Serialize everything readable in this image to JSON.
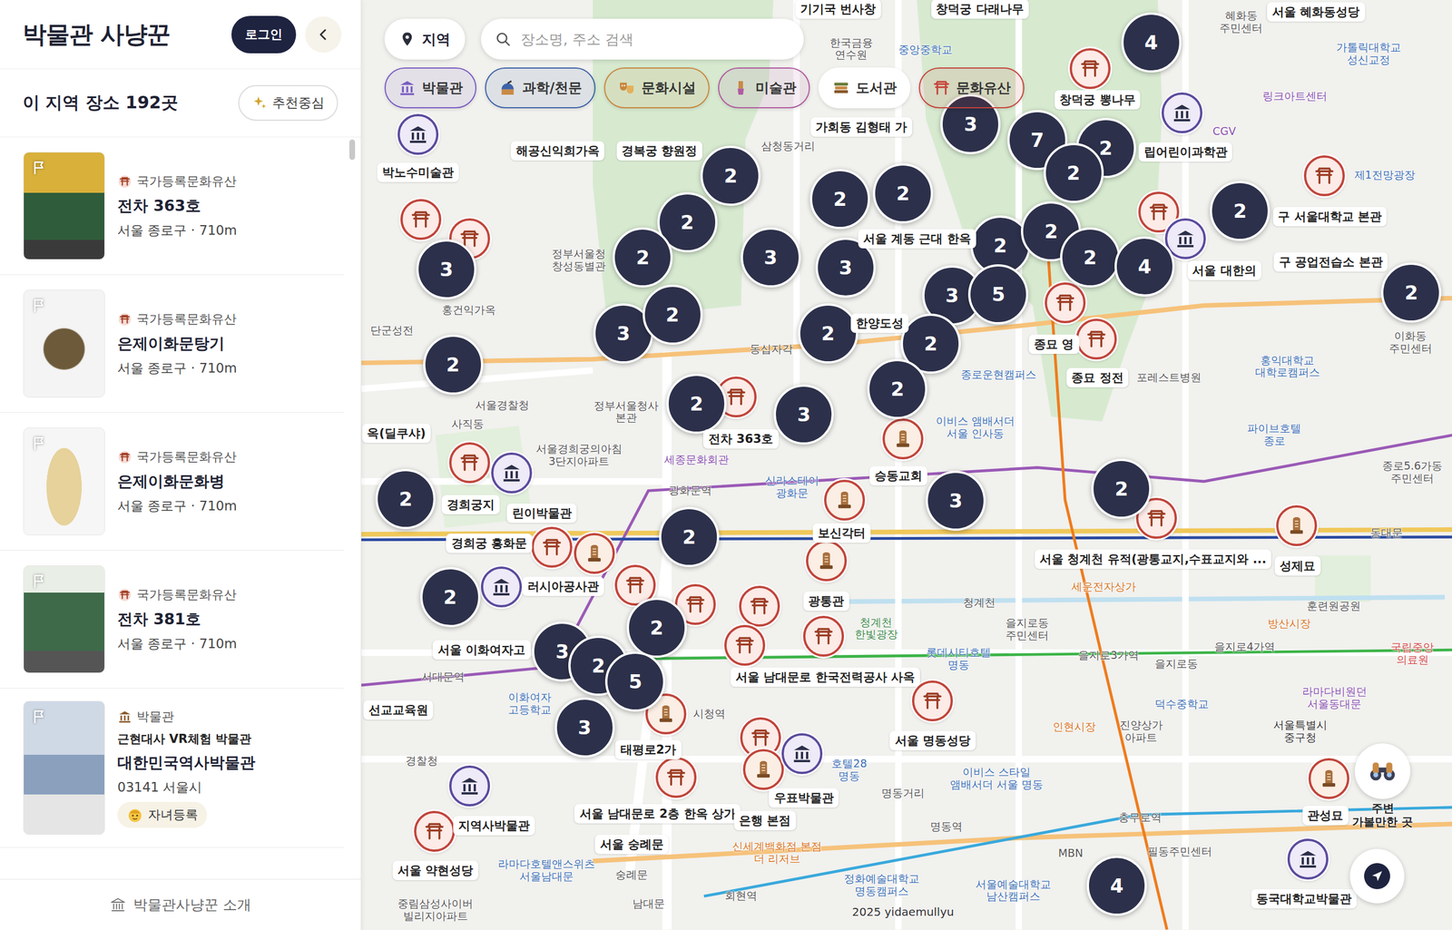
{
  "sidebar": {
    "title": "박물관 사냥꾼",
    "login": "로그인",
    "count": "이 지역 장소 192곳",
    "sort": "추천중심",
    "footer": "박물관사냥꾼 소개"
  },
  "places": [
    {
      "kind": "heritage",
      "category": "국가등록문화유산",
      "title": "전차 363호",
      "meta": "서울 종로구 · 710m"
    },
    {
      "kind": "heritage",
      "category": "국가등록문화유산",
      "title": "은제이화문탕기",
      "meta": "서울 종로구 · 710m"
    },
    {
      "kind": "heritage",
      "category": "국가등록문화유산",
      "title": "은제이화문화병",
      "meta": "서울 종로구 · 710m"
    },
    {
      "kind": "heritage",
      "category": "국가등록문화유산",
      "title": "전차 381호",
      "meta": "서울 종로구 · 710m"
    },
    {
      "kind": "museum",
      "category": "박물관",
      "subtitle": "근현대사 VR체험 박물관",
      "title": "대한민국역사박물관",
      "meta": "03141 서울시",
      "badge": "자녀등록"
    }
  ],
  "map": {
    "region": "지역",
    "search_placeholder": "장소명, 주소 검색",
    "filters": [
      {
        "label": "박물관",
        "kind": "museum",
        "selected": true,
        "color": "#7a5cc2"
      },
      {
        "label": "과학/천문",
        "kind": "science",
        "selected": true,
        "color": "#3f63a8"
      },
      {
        "label": "문화시설",
        "kind": "culture",
        "selected": true,
        "color": "#c8873f"
      },
      {
        "label": "미술관",
        "kind": "art",
        "selected": true,
        "color": "#b05aa0"
      },
      {
        "label": "도서관",
        "kind": "library",
        "selected": false,
        "color": "#6b7d3a"
      },
      {
        "label": "문화유산",
        "kind": "heritage",
        "selected": true,
        "color": "#c7443b"
      }
    ],
    "clusters": [
      {
        "count": "4"
      },
      {
        "count": "3"
      },
      {
        "count": "7"
      },
      {
        "count": "2"
      },
      {
        "count": "2"
      },
      {
        "count": "2"
      },
      {
        "count": "2"
      },
      {
        "count": "2"
      },
      {
        "count": "2"
      },
      {
        "count": "2"
      },
      {
        "count": "2"
      },
      {
        "count": "3"
      },
      {
        "count": "3"
      },
      {
        "count": "2"
      },
      {
        "count": "2"
      },
      {
        "count": "2"
      },
      {
        "count": "4"
      },
      {
        "count": "3"
      },
      {
        "count": "5"
      },
      {
        "count": "2"
      },
      {
        "count": "3"
      },
      {
        "count": "2"
      },
      {
        "count": "3"
      },
      {
        "count": "2"
      },
      {
        "count": "2"
      },
      {
        "count": "2"
      },
      {
        "count": "2"
      },
      {
        "count": "2"
      },
      {
        "count": "3"
      },
      {
        "count": "3"
      },
      {
        "count": "2"
      },
      {
        "count": "2"
      },
      {
        "count": "2"
      },
      {
        "count": "2"
      },
      {
        "count": "2"
      },
      {
        "count": "3"
      },
      {
        "count": "2"
      },
      {
        "count": "5"
      },
      {
        "count": "3"
      },
      {
        "count": "4"
      }
    ],
    "pins": [
      {
        "kind": "heritage"
      },
      {
        "kind": "heritage"
      },
      {
        "kind": "heritage"
      },
      {
        "kind": "heritage"
      },
      {
        "kind": "heritage"
      },
      {
        "kind": "heritage"
      },
      {
        "kind": "heritage"
      },
      {
        "kind": "heritage"
      },
      {
        "kind": "stele"
      },
      {
        "kind": "stele"
      },
      {
        "kind": "heritage"
      },
      {
        "kind": "heritage"
      },
      {
        "kind": "stele"
      },
      {
        "kind": "stele"
      },
      {
        "kind": "stele"
      },
      {
        "kind": "heritage"
      },
      {
        "kind": "heritage"
      },
      {
        "kind": "heritage"
      },
      {
        "kind": "heritage"
      },
      {
        "kind": "heritage"
      },
      {
        "kind": "heritage"
      },
      {
        "kind": "stele"
      },
      {
        "kind": "heritage"
      },
      {
        "kind": "stele"
      },
      {
        "kind": "heritage"
      },
      {
        "kind": "heritage"
      },
      {
        "kind": "heritage"
      },
      {
        "kind": "stele"
      },
      {
        "kind": "museum"
      },
      {
        "kind": "museum"
      },
      {
        "kind": "museum"
      },
      {
        "kind": "museum"
      },
      {
        "kind": "museum"
      },
      {
        "kind": "museum"
      },
      {
        "kind": "museum"
      },
      {
        "kind": "museum"
      }
    ],
    "poi_labels": [
      "기기국 번사창",
      "창덕궁 다래나무",
      "서울 혜화동성당",
      "가회동 김형태 가",
      "창덕궁 뽕나무",
      "립어린이과학관",
      "구 서울대학교 본관",
      "구 공업전습소 본관",
      "서울 대한의",
      "해공신익희가옥",
      "경복궁 향원정",
      "박노수미술관",
      "서울 계동 근대 한옥",
      "한양도성",
      "종묘 영",
      "종묘 정전",
      "전차 363호",
      "옥(딜쿠샤)",
      "경희궁지",
      "린이박물관",
      "경희궁 흥화문",
      "러시아공사관",
      "보신각터",
      "광통관",
      "승동교회",
      "서울 청계천 유적(광통교지,수표교지와 ...",
      "성제묘",
      "서울 이화여자고",
      "서울 남대문로 한국전력공사 사옥",
      "서울 명동성당",
      "태평로2가",
      "서울 남대문로 2층 한옥 상가",
      "서울 숭례문",
      "서울 약현성당",
      "지역사박물관",
      "우표박물관",
      "은행 본점",
      "관성묘",
      "동국대학교박물관",
      "선교교육원"
    ],
    "base_labels": [
      {
        "text": "혜화동\n주민센터",
        "color": "#555555"
      },
      {
        "text": "가톨릭대학교\n성신교정",
        "color": "#3b6fb6"
      },
      {
        "text": "링크아트센터",
        "color": "#8a4fb0"
      },
      {
        "text": "CGV",
        "color": "#8a4fb0"
      },
      {
        "text": "제1전망광장",
        "color": "#3b6fb6"
      },
      {
        "text": "이화동\n주민센터",
        "color": "#555555"
      },
      {
        "text": "홍익대학교\n대학로캠퍼스",
        "color": "#3b6fb6"
      },
      {
        "text": "파이브호텔\n종로",
        "color": "#3b6fb6"
      },
      {
        "text": "포레스트병원",
        "color": "#555555"
      },
      {
        "text": "종로5.6가동\n주민센터",
        "color": "#555555"
      },
      {
        "text": "동대문",
        "color": "#555555"
      },
      {
        "text": "방산시장",
        "color": "#d9731b"
      },
      {
        "text": "훈련원공원",
        "color": "#555555"
      },
      {
        "text": "국립중앙\n의료원",
        "color": "#d44a4a"
      },
      {
        "text": "라마다비원던\n서울동대문",
        "color": "#8a4fb0"
      },
      {
        "text": "을지로4가역",
        "color": "#555555"
      },
      {
        "text": "을지로3가역",
        "color": "#555555"
      },
      {
        "text": "을지로동",
        "color": "#555555"
      },
      {
        "text": "덕수중학교",
        "color": "#3b6fb6"
      },
      {
        "text": "서울특별시\n중구청",
        "color": "#333333"
      },
      {
        "text": "진양상가\n아파트",
        "color": "#555555"
      },
      {
        "text": "충무로역",
        "color": "#555555"
      },
      {
        "text": "필동주민센터",
        "color": "#555555"
      },
      {
        "text": "세운전자상가",
        "color": "#d9731b"
      },
      {
        "text": "청계천",
        "color": "#555555"
      },
      {
        "text": "을지로동\n주민센터",
        "color": "#555555"
      },
      {
        "text": "롯데시티호텔\n명동",
        "color": "#3b6fb6"
      },
      {
        "text": "인현시장",
        "color": "#d9731b"
      },
      {
        "text": "이비스 앰배서더\n서울 인사동",
        "color": "#3b6fb6"
      },
      {
        "text": "정부서울청사\n본관",
        "color": "#555555"
      },
      {
        "text": "서울경찰청",
        "color": "#555555"
      },
      {
        "text": "사직동",
        "color": "#555555"
      },
      {
        "text": "세종문화회관",
        "color": "#8a4fb0"
      },
      {
        "text": "광화문역",
        "color": "#555555"
      },
      {
        "text": "신라스테이\n광화문",
        "color": "#3b6fb6"
      },
      {
        "text": "서울경희궁의아침\n3단지아파트",
        "color": "#555555"
      },
      {
        "text": "서대문역",
        "color": "#555555"
      },
      {
        "text": "이화여자\n고등학교",
        "color": "#3b6fb6"
      },
      {
        "text": "경찰청",
        "color": "#555555"
      },
      {
        "text": "시청역",
        "color": "#555555"
      },
      {
        "text": "라마다호텔앤스위츠\n서울남대문",
        "color": "#3b6fb6"
      },
      {
        "text": "신세계백화점 본점\n더 리저브",
        "color": "#d9731b"
      },
      {
        "text": "정화예술대학교\n명동캠퍼스",
        "color": "#3b6fb6"
      },
      {
        "text": "서울예술대학교\n남산캠퍼스",
        "color": "#3b6fb6"
      },
      {
        "text": "명동역",
        "color": "#555555"
      },
      {
        "text": "회현역",
        "color": "#555555"
      },
      {
        "text": "남대문",
        "color": "#555555"
      },
      {
        "text": "중림삼성사이버\n빌리지아파트",
        "color": "#555555"
      },
      {
        "text": "MBN",
        "color": "#555555"
      },
      {
        "text": "이비스 스타일\n앰배서더 서울 명동",
        "color": "#3b6fb6"
      },
      {
        "text": "호텔28\n명동",
        "color": "#3b6fb6"
      },
      {
        "text": "명동거리",
        "color": "#555555"
      },
      {
        "text": "숭례문",
        "color": "#555555"
      },
      {
        "text": "청계천\n한빛광장",
        "color": "#3a8a4a"
      },
      {
        "text": "중앙중학교",
        "color": "#3b6fb6"
      },
      {
        "text": "한국금융\n연수원",
        "color": "#555555"
      },
      {
        "text": "삼청동거리",
        "color": "#555555"
      },
      {
        "text": "정부서울청\n창성동별관",
        "color": "#555555"
      },
      {
        "text": "홍건익가옥",
        "color": "#555555"
      },
      {
        "text": "단군성전",
        "color": "#555555"
      },
      {
        "text": "동십자각",
        "color": "#555555"
      },
      {
        "text": "종로운현캠퍼스",
        "color": "#3b6fb6"
      }
    ],
    "nearby": "주변\n가볼만한 곳",
    "attribution": "2025 yidaemullyu"
  }
}
